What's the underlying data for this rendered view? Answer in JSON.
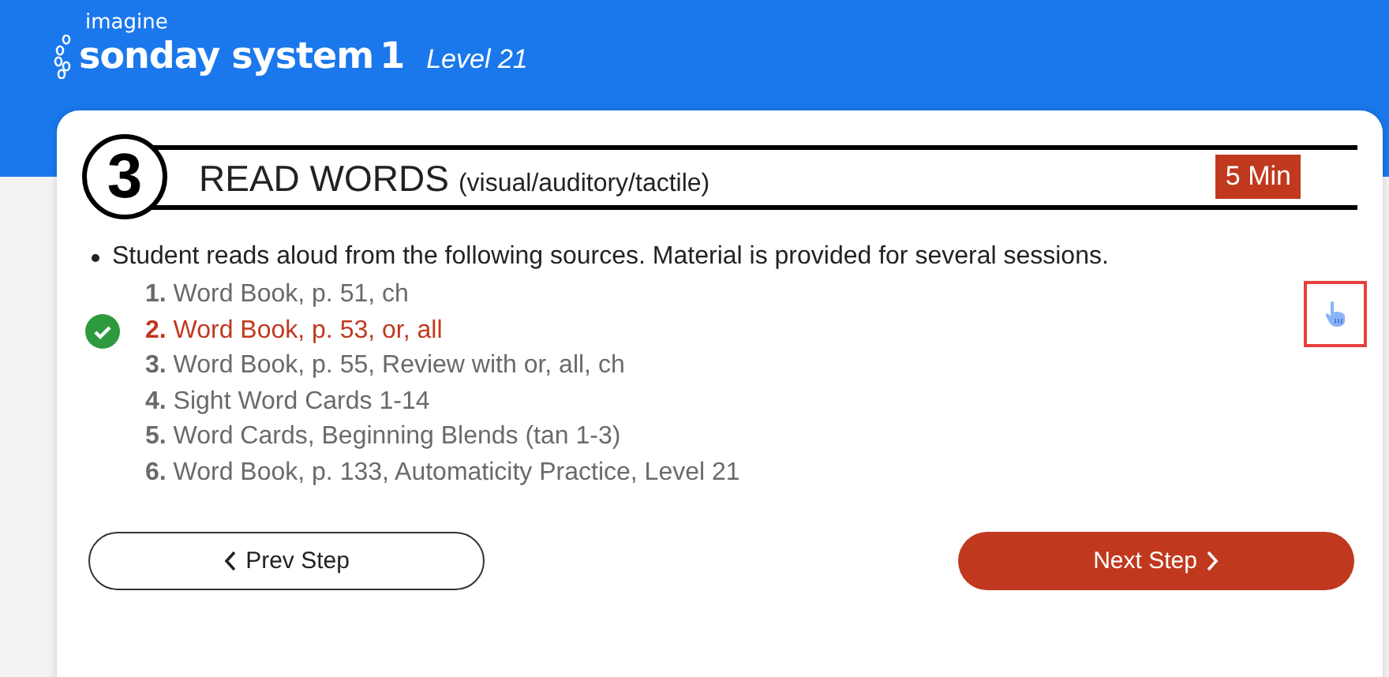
{
  "header": {
    "brand_small": "imagine",
    "brand": "sonday system",
    "brand_number": "1",
    "level": "Level 21"
  },
  "step": {
    "number": "3",
    "title": "READ WORDS",
    "subtitle": "(visual/auditory/tactile)",
    "duration": "5 Min"
  },
  "instruction": "Student reads aloud from the following sources. Material is provided for several sessions.",
  "sources": [
    {
      "number": "1.",
      "text": "Word Book, p. 51, ch",
      "selected": false
    },
    {
      "number": "2.",
      "text": "Word Book, p. 53, or, all",
      "selected": true
    },
    {
      "number": "3.",
      "text": "Word Book, p. 55, Review with or, all, ch",
      "selected": false
    },
    {
      "number": "4.",
      "text": "Sight Word Cards 1-14",
      "selected": false
    },
    {
      "number": "5.",
      "text": "Word Cards, Beginning Blends (tan 1-3)",
      "selected": false
    },
    {
      "number": "6.",
      "text": "Word Book, p. 133, Automaticity Practice, Level 21",
      "selected": false
    }
  ],
  "buttons": {
    "prev": "Prev Step",
    "next": "Next Step"
  }
}
